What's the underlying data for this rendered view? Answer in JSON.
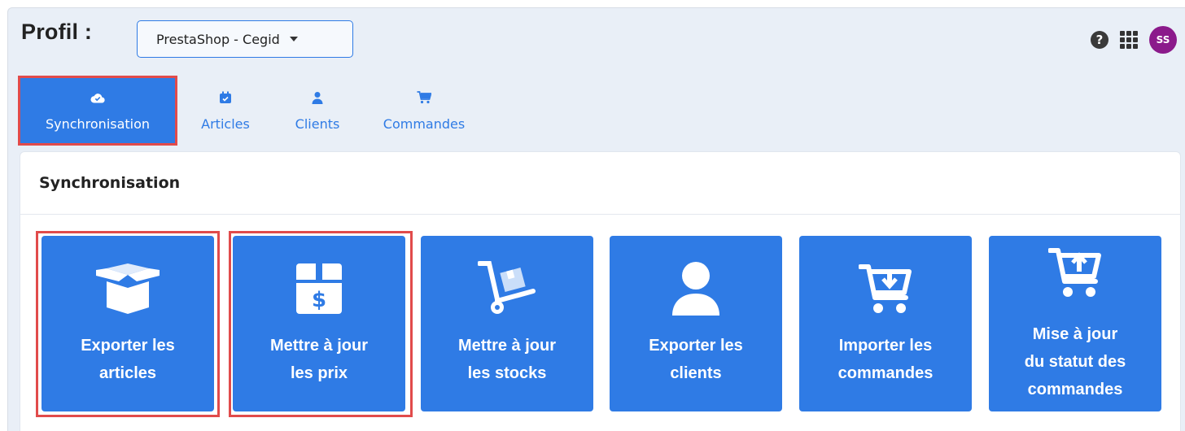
{
  "header": {
    "profil_label": "Profil :",
    "profile_select": "PrestaShop - Cegid",
    "help_glyph": "?",
    "avatar_initials": "SS",
    "avatar_color": "#8b1a8b"
  },
  "tabs": [
    {
      "label": "Synchronisation",
      "icon": "cloud-check-icon",
      "active": true
    },
    {
      "label": "Articles",
      "icon": "calendar-box-icon",
      "active": false
    },
    {
      "label": "Clients",
      "icon": "user-icon",
      "active": false
    },
    {
      "label": "Commandes",
      "icon": "cart-icon",
      "active": false
    }
  ],
  "card": {
    "title": "Synchronisation",
    "tiles": [
      {
        "label": "Exporter les\narticles",
        "icon": "open-box-icon",
        "highlighted": true
      },
      {
        "label": "Mettre à jour\nles prix",
        "icon": "price-box-icon",
        "highlighted": true
      },
      {
        "label": "Mettre à jour\nles stocks",
        "icon": "hand-truck-icon",
        "highlighted": false
      },
      {
        "label": "Exporter les\nclients",
        "icon": "person-icon",
        "highlighted": false
      },
      {
        "label": "Importer les\ncommandes",
        "icon": "cart-download-icon",
        "highlighted": false
      },
      {
        "label": "Mise à jour\ndu statut des\ncommandes",
        "icon": "cart-upload-icon",
        "highlighted": false
      }
    ]
  },
  "colors": {
    "primary": "#2f7be5",
    "highlight_border": "#e14b4b",
    "background": "#e9eff7"
  }
}
